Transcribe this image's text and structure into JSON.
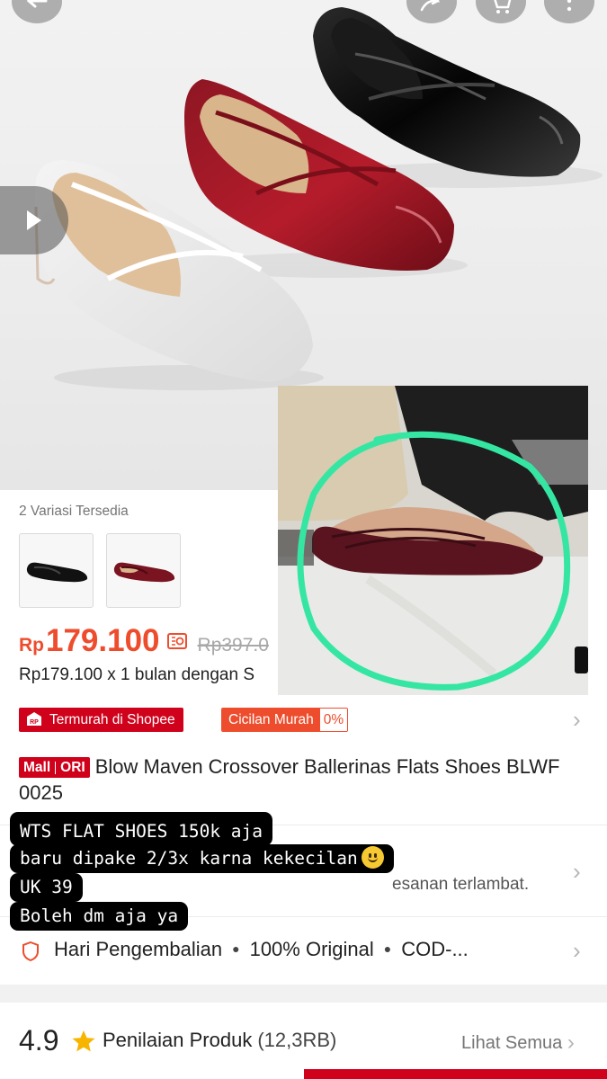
{
  "product": {
    "variations_label": "2 Variasi Tersedia",
    "variations": [
      {
        "name": "black-flat",
        "color": "#111111"
      },
      {
        "name": "maroon-flat",
        "color": "#7a1420"
      }
    ],
    "price_currency": "Rp",
    "price": "179.100",
    "price_original": "Rp397.0",
    "installment_text": "Rp179.100 x 1 bulan dengan S",
    "badges": {
      "termurah": "Termurah di Shopee",
      "termurah_icon_text": "RP",
      "cicilan": "Cicilan Murah",
      "cicilan_pct": "0%"
    },
    "mall_badge": {
      "mall": "Mall",
      "ori": "ORI"
    },
    "title": "Blow Maven Crossover Ballerinas Flats Shoes BLWF 0025",
    "shipping_note": "esanan terlambat.",
    "guarantee": {
      "returns": "Hari Pengembalian",
      "original": "100% Original",
      "cod": "COD-..."
    },
    "rating": {
      "score": "4.9",
      "label": "Penilaian Produk",
      "count": "(12,3RB)",
      "see_all": "Lihat Semua"
    }
  },
  "overlay_text": {
    "line1": "WTS FLAT SHOES 150k aja",
    "line2": "baru dipake 2/3x karna kekecilan",
    "line3": "UK 39",
    "line4": "Boleh dm aja ya"
  },
  "colors": {
    "accent": "#ee4d2d",
    "mall_red": "#d0011b",
    "highlight_circle": "#35e6a3"
  }
}
